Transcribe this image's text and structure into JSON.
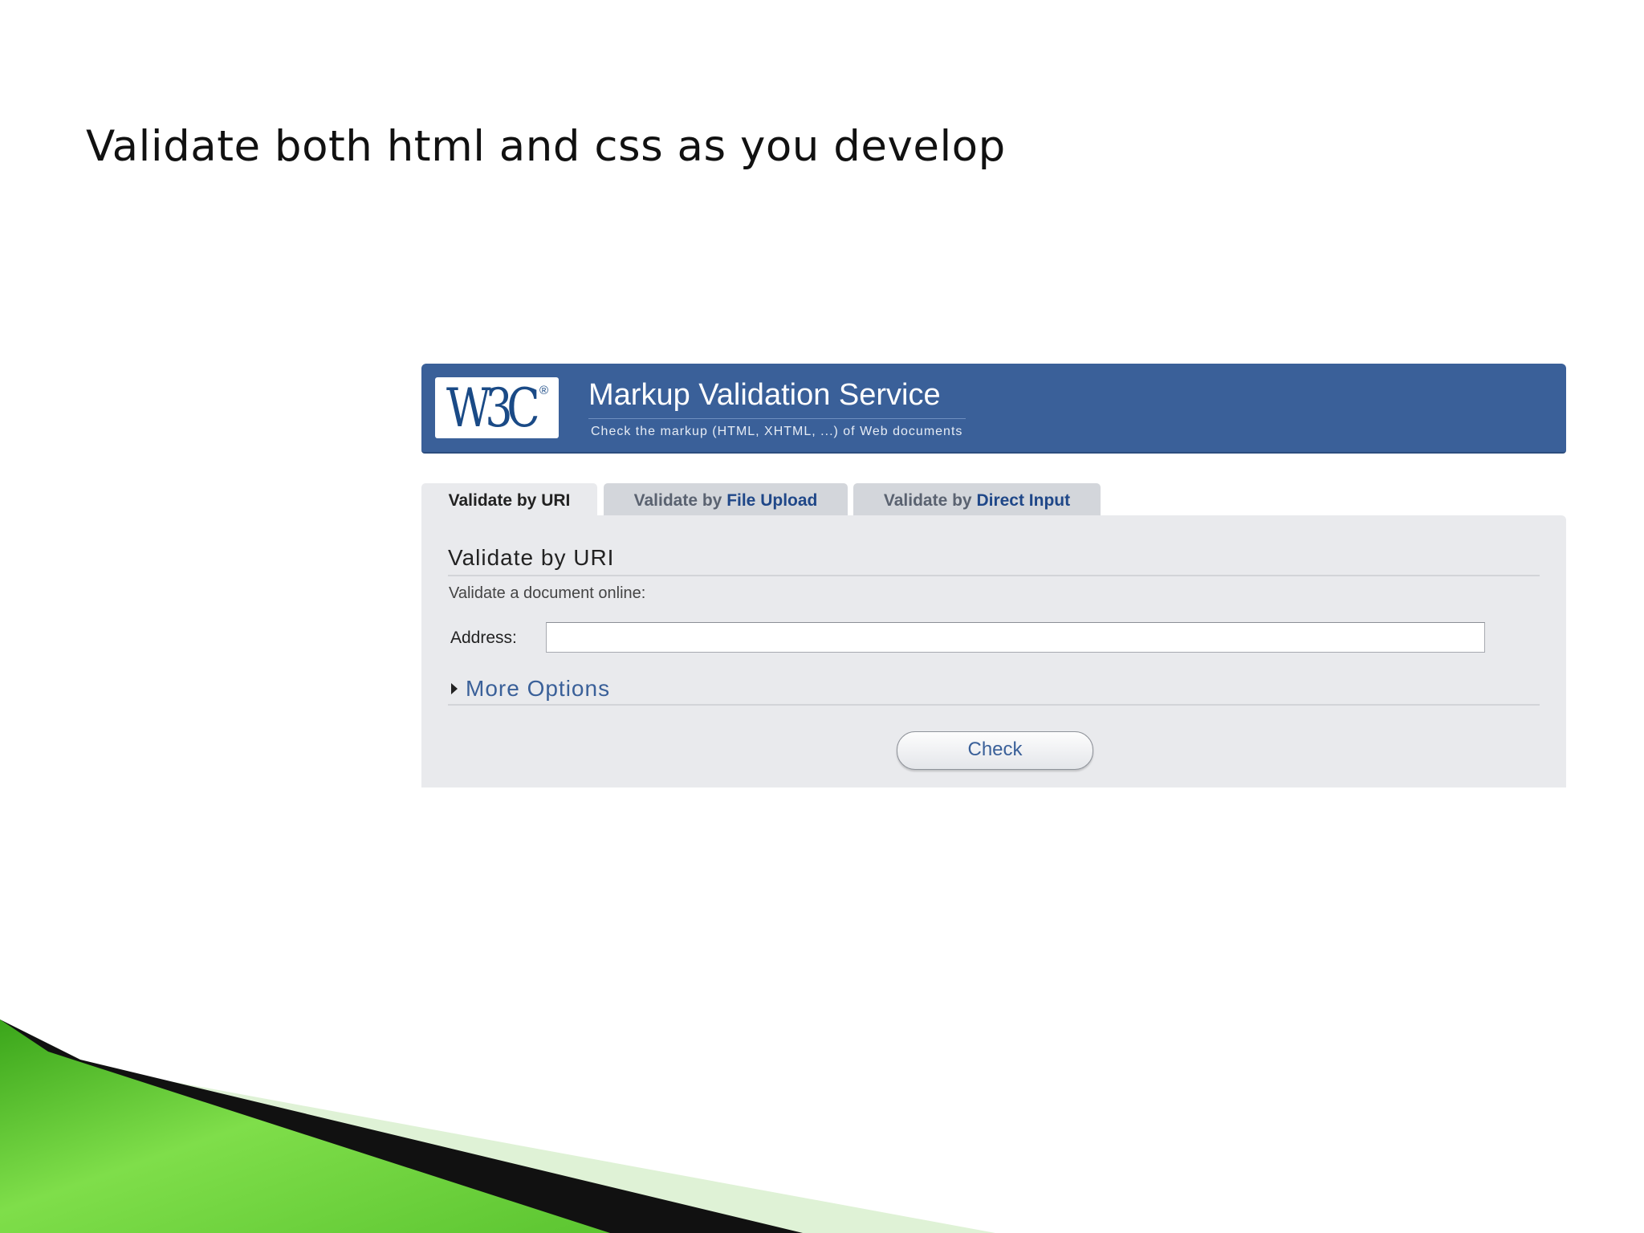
{
  "slide": {
    "title": "Validate both html and css as you develop"
  },
  "header": {
    "logo_text": "W3C",
    "logo_mark": "®",
    "title": "Markup Validation Service",
    "subtitle": "Check the markup (HTML, XHTML, ...) of Web documents"
  },
  "tabs": [
    {
      "prefix": "Validate by ",
      "emphasis": "URI",
      "active": true
    },
    {
      "prefix": "Validate by ",
      "emphasis": "File Upload",
      "active": false
    },
    {
      "prefix": "Validate by ",
      "emphasis": "Direct Input",
      "active": false
    }
  ],
  "form": {
    "section_title": "Validate by URI",
    "lead": "Validate a document online:",
    "address_label": "Address:",
    "address_value": "",
    "more_options_label": "More Options",
    "more_options_icon": "caret-right-icon",
    "check_label": "Check"
  },
  "colors": {
    "banner": "#3a6099",
    "panel": "#e9eaed",
    "accent": "#3a6099",
    "swoosh_green": "#5cc531"
  }
}
